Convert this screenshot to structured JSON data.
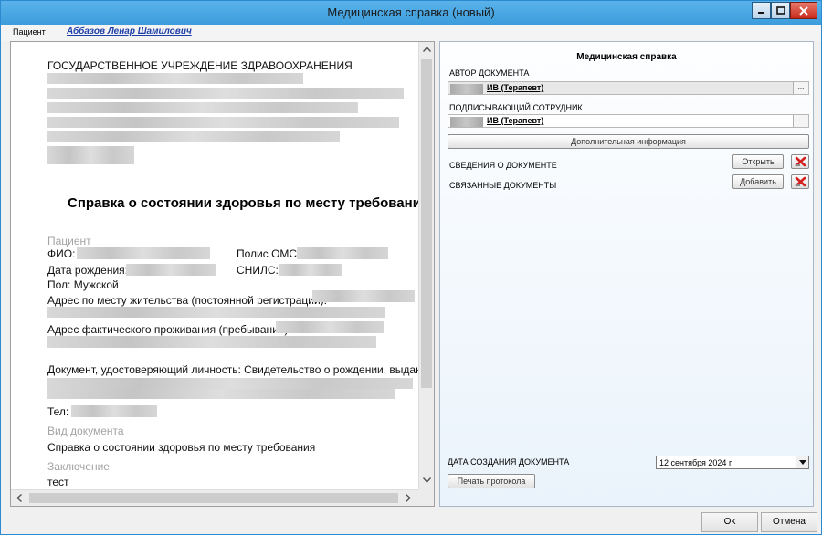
{
  "window": {
    "title": "Медицинская справка (новый)"
  },
  "patient_bar": {
    "label": "Пациент",
    "name": "Аббазов Ленар Шамилович"
  },
  "document": {
    "institution": "ГОСУДАРСТВЕННОЕ УЧРЕЖДЕНИЕ ЗДРАВООХРАНЕНИЯ",
    "heading": "Справка о состоянии здоровья по месту требования",
    "patient_section": "Пациент",
    "fio_label": "ФИО:",
    "oms_label": "Полис ОМС:",
    "dob_label": "Дата рождения:",
    "snils_label": "СНИЛС:",
    "gender": "Пол: Мужской",
    "address_reg_label": "Адрес по месту жительства (постоянной регистрации):",
    "address_actual_label": "Адрес фактического проживания (пребывания):",
    "identity_doc": "Документ, удостоверяющий личность: Свидетельство о рождении, выданное",
    "phone_label": "Тел:",
    "doc_type_section": "Вид документа",
    "doc_type_value": "Справка о состоянии здоровья по месту требования",
    "conclusion_section": "Заключение",
    "conclusion_value": "тест"
  },
  "right_panel": {
    "title": "Медицинская справка",
    "author_label": "АВТОР ДОКУМЕНТА",
    "author_value": "ИВ (Терапевт)",
    "signer_label": "ПОДПИСЫВАЮЩИЙ СОТРУДНИК",
    "signer_value": "ИВ (Терапевт)",
    "combo_button": "...",
    "extra_info_button": "Дополнительная информация",
    "doc_info_label": "СВЕДЕНИЯ О ДОКУМЕНТЕ",
    "open_button": "Открыть",
    "related_docs_label": "СВЯЗАННЫЕ ДОКУМЕНТЫ",
    "add_button": "Добавить",
    "creation_date_label": "ДАТА СОЗДАНИЯ ДОКУМЕНТА",
    "creation_date_value": "12 сентября 2024 г.",
    "print_button": "Печать протокола"
  },
  "footer": {
    "ok_button": "Ok",
    "cancel_button": "Отмена"
  },
  "colors": {
    "titlebar": "#3c9ddc",
    "close_button": "#c72b1c",
    "patient_link": "#1f3fa8"
  }
}
